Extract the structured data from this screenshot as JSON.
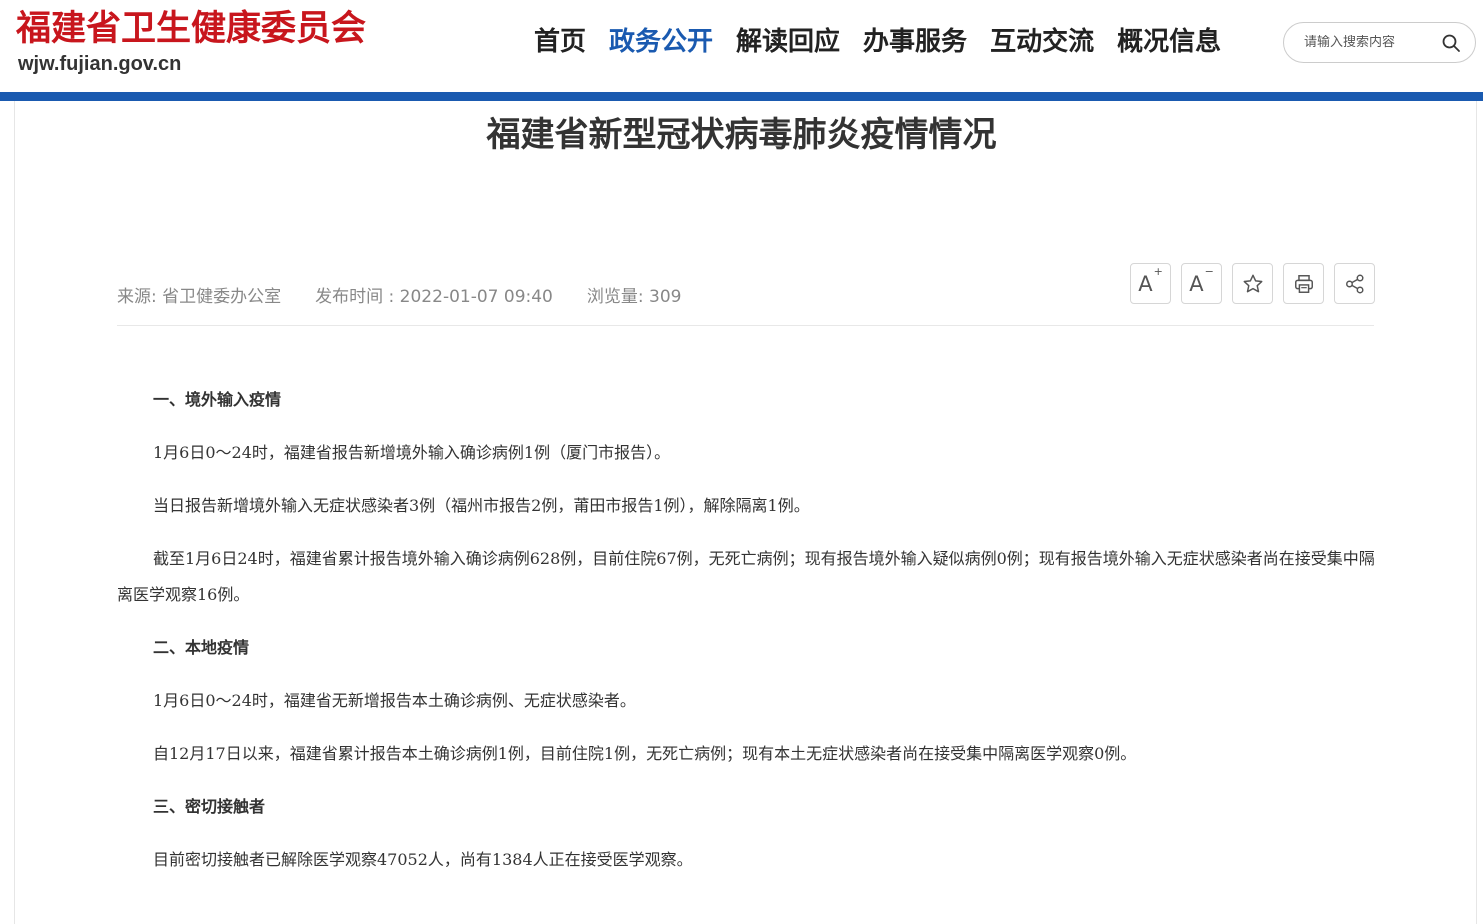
{
  "header": {
    "logo_title": "福建省卫生健康委员会",
    "logo_url": "wjw.fujian.gov.cn",
    "nav": [
      {
        "label": "首页",
        "active": false
      },
      {
        "label": "政务公开",
        "active": true
      },
      {
        "label": "解读回应",
        "active": false
      },
      {
        "label": "办事服务",
        "active": false
      },
      {
        "label": "互动交流",
        "active": false
      },
      {
        "label": "概况信息",
        "active": false
      }
    ],
    "search": {
      "placeholder": "请输入搜索内容",
      "value": ""
    }
  },
  "article": {
    "title": "福建省新型冠状病毒肺炎疫情情况",
    "meta": {
      "source": "来源: 省卫健委办公室",
      "publish_time": "发布时间 : 2022-01-07 09:40",
      "views": "浏览量:  309"
    },
    "tools": [
      {
        "name": "font-increase",
        "label": "A",
        "mark": "+"
      },
      {
        "name": "font-decrease",
        "label": "A",
        "mark": "−"
      },
      {
        "name": "favorite",
        "label": ""
      },
      {
        "name": "print",
        "label": ""
      },
      {
        "name": "share",
        "label": ""
      }
    ],
    "paragraphs": [
      {
        "type": "head",
        "text": "一、境外输入疫情"
      },
      {
        "type": "text",
        "text": "1月6日0～24时，福建省报告新增境外输入确诊病例1例（厦门市报告）。"
      },
      {
        "type": "text",
        "text": "当日报告新增境外输入无症状感染者3例（福州市报告2例，莆田市报告1例），解除隔离1例。"
      },
      {
        "type": "text",
        "text": "截至1月6日24时，福建省累计报告境外输入确诊病例628例，目前住院67例，无死亡病例；现有报告境外输入疑似病例0例；现有报告境外输入无症状感染者尚在接受集中隔离医学观察16例。"
      },
      {
        "type": "head",
        "text": "二、本地疫情"
      },
      {
        "type": "text",
        "text": "1月6日0～24时，福建省无新增报告本土确诊病例、无症状感染者。"
      },
      {
        "type": "text",
        "text": "自12月17日以来，福建省累计报告本土确诊病例1例，目前住院1例，无死亡病例；现有本土无症状感染者尚在接受集中隔离医学观察0例。"
      },
      {
        "type": "head",
        "text": "三、密切接触者"
      },
      {
        "type": "text",
        "text": "目前密切接触者已解除医学观察47052人，尚有1384人正在接受医学观察。"
      }
    ]
  },
  "colors": {
    "brand_red": "#c8161d",
    "brand_blue": "#1a5ab0"
  }
}
